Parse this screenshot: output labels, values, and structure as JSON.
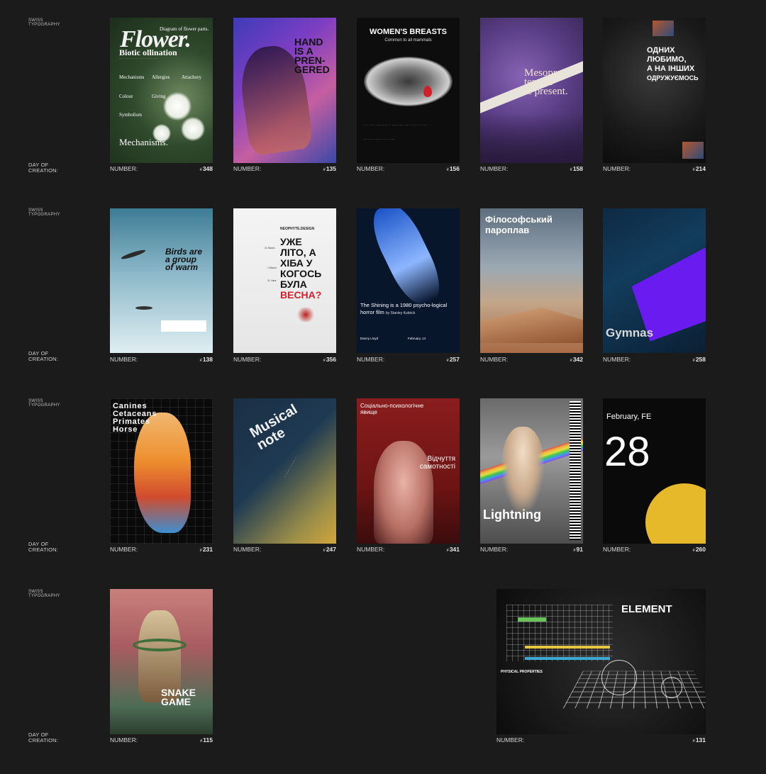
{
  "row_label_top": "Swiss\nTypography",
  "row_label_bottom": "Day of\ncreation:",
  "caption_label": "NUMBER:",
  "posters": [
    {
      "id": "p348",
      "number": "348",
      "title": "Flower.",
      "subtitle": "Diagram of flower parts.",
      "heading": "Biotic ollination",
      "words": [
        "Mechanisms",
        "Allergies",
        "Attachory",
        "Colour",
        "Giving",
        "Symbolism"
      ],
      "footer": "Mechanisms."
    },
    {
      "id": "p135",
      "number": "135",
      "lines": [
        "HAND",
        "IS A",
        "PREN-",
        "GERED"
      ]
    },
    {
      "id": "p156",
      "number": "156",
      "title": "WOMEN'S BREASTS",
      "subtitle": "Common to all mammals"
    },
    {
      "id": "p158",
      "number": "158",
      "lines": [
        "Mesopra",
        "tero zo",
        "ic present."
      ]
    },
    {
      "id": "p214",
      "number": "214",
      "lines": [
        "ОДНИХ",
        "ЛЮБИМО,",
        "А НА ІНШИХ",
        "ОДРУЖУЄМОСЬ"
      ]
    },
    {
      "id": "p138",
      "number": "138",
      "lines": [
        "Birds are",
        "a group",
        "of warm"
      ]
    },
    {
      "id": "p356",
      "number": "356",
      "brand": "NEOPHYTE.DESIGN",
      "lines": [
        "УЖЕ",
        "ЛІТО, А",
        "ХІБА У",
        "КОГОСЬ",
        "БУЛА"
      ],
      "accent": "ВЕСНА?",
      "dates": [
        "21 March",
        "1 March",
        "21 June"
      ]
    },
    {
      "id": "p257",
      "number": "257",
      "title": "The Shining is a 1980 psycho-logical horror film",
      "byline": "by Stanley Kubrick",
      "left": "Danny Lloyd",
      "right": "February, 14"
    },
    {
      "id": "p342",
      "number": "342",
      "title": "Філософський пароплав"
    },
    {
      "id": "p258",
      "number": "258",
      "title": "Gymnas"
    },
    {
      "id": "p231",
      "number": "231",
      "lines": [
        "Canines",
        "Cetaceans",
        "Primates",
        "Horse"
      ]
    },
    {
      "id": "p247",
      "number": "247",
      "lines": [
        "Musical",
        "note"
      ]
    },
    {
      "id": "p341",
      "number": "341",
      "title": "Соціально-психологічне явище",
      "lines": [
        "Відчуття",
        "самотності"
      ]
    },
    {
      "id": "p91",
      "number": "91",
      "title": "Lightning"
    },
    {
      "id": "p260",
      "number": "260",
      "title": "February, FE",
      "big": "28"
    },
    {
      "id": "p115",
      "number": "115",
      "lines": [
        "SNAKE",
        "GAME"
      ]
    },
    {
      "id": "p131",
      "number": "131",
      "title": "ELEMENT",
      "subhead": "PHYSICAL PROPERTIES"
    }
  ],
  "colors": {
    "background": "#1b1b1b",
    "accent_red": "#d0202a",
    "accent_violet": "#6a1cf0",
    "accent_yellow": "#e6b92a"
  }
}
